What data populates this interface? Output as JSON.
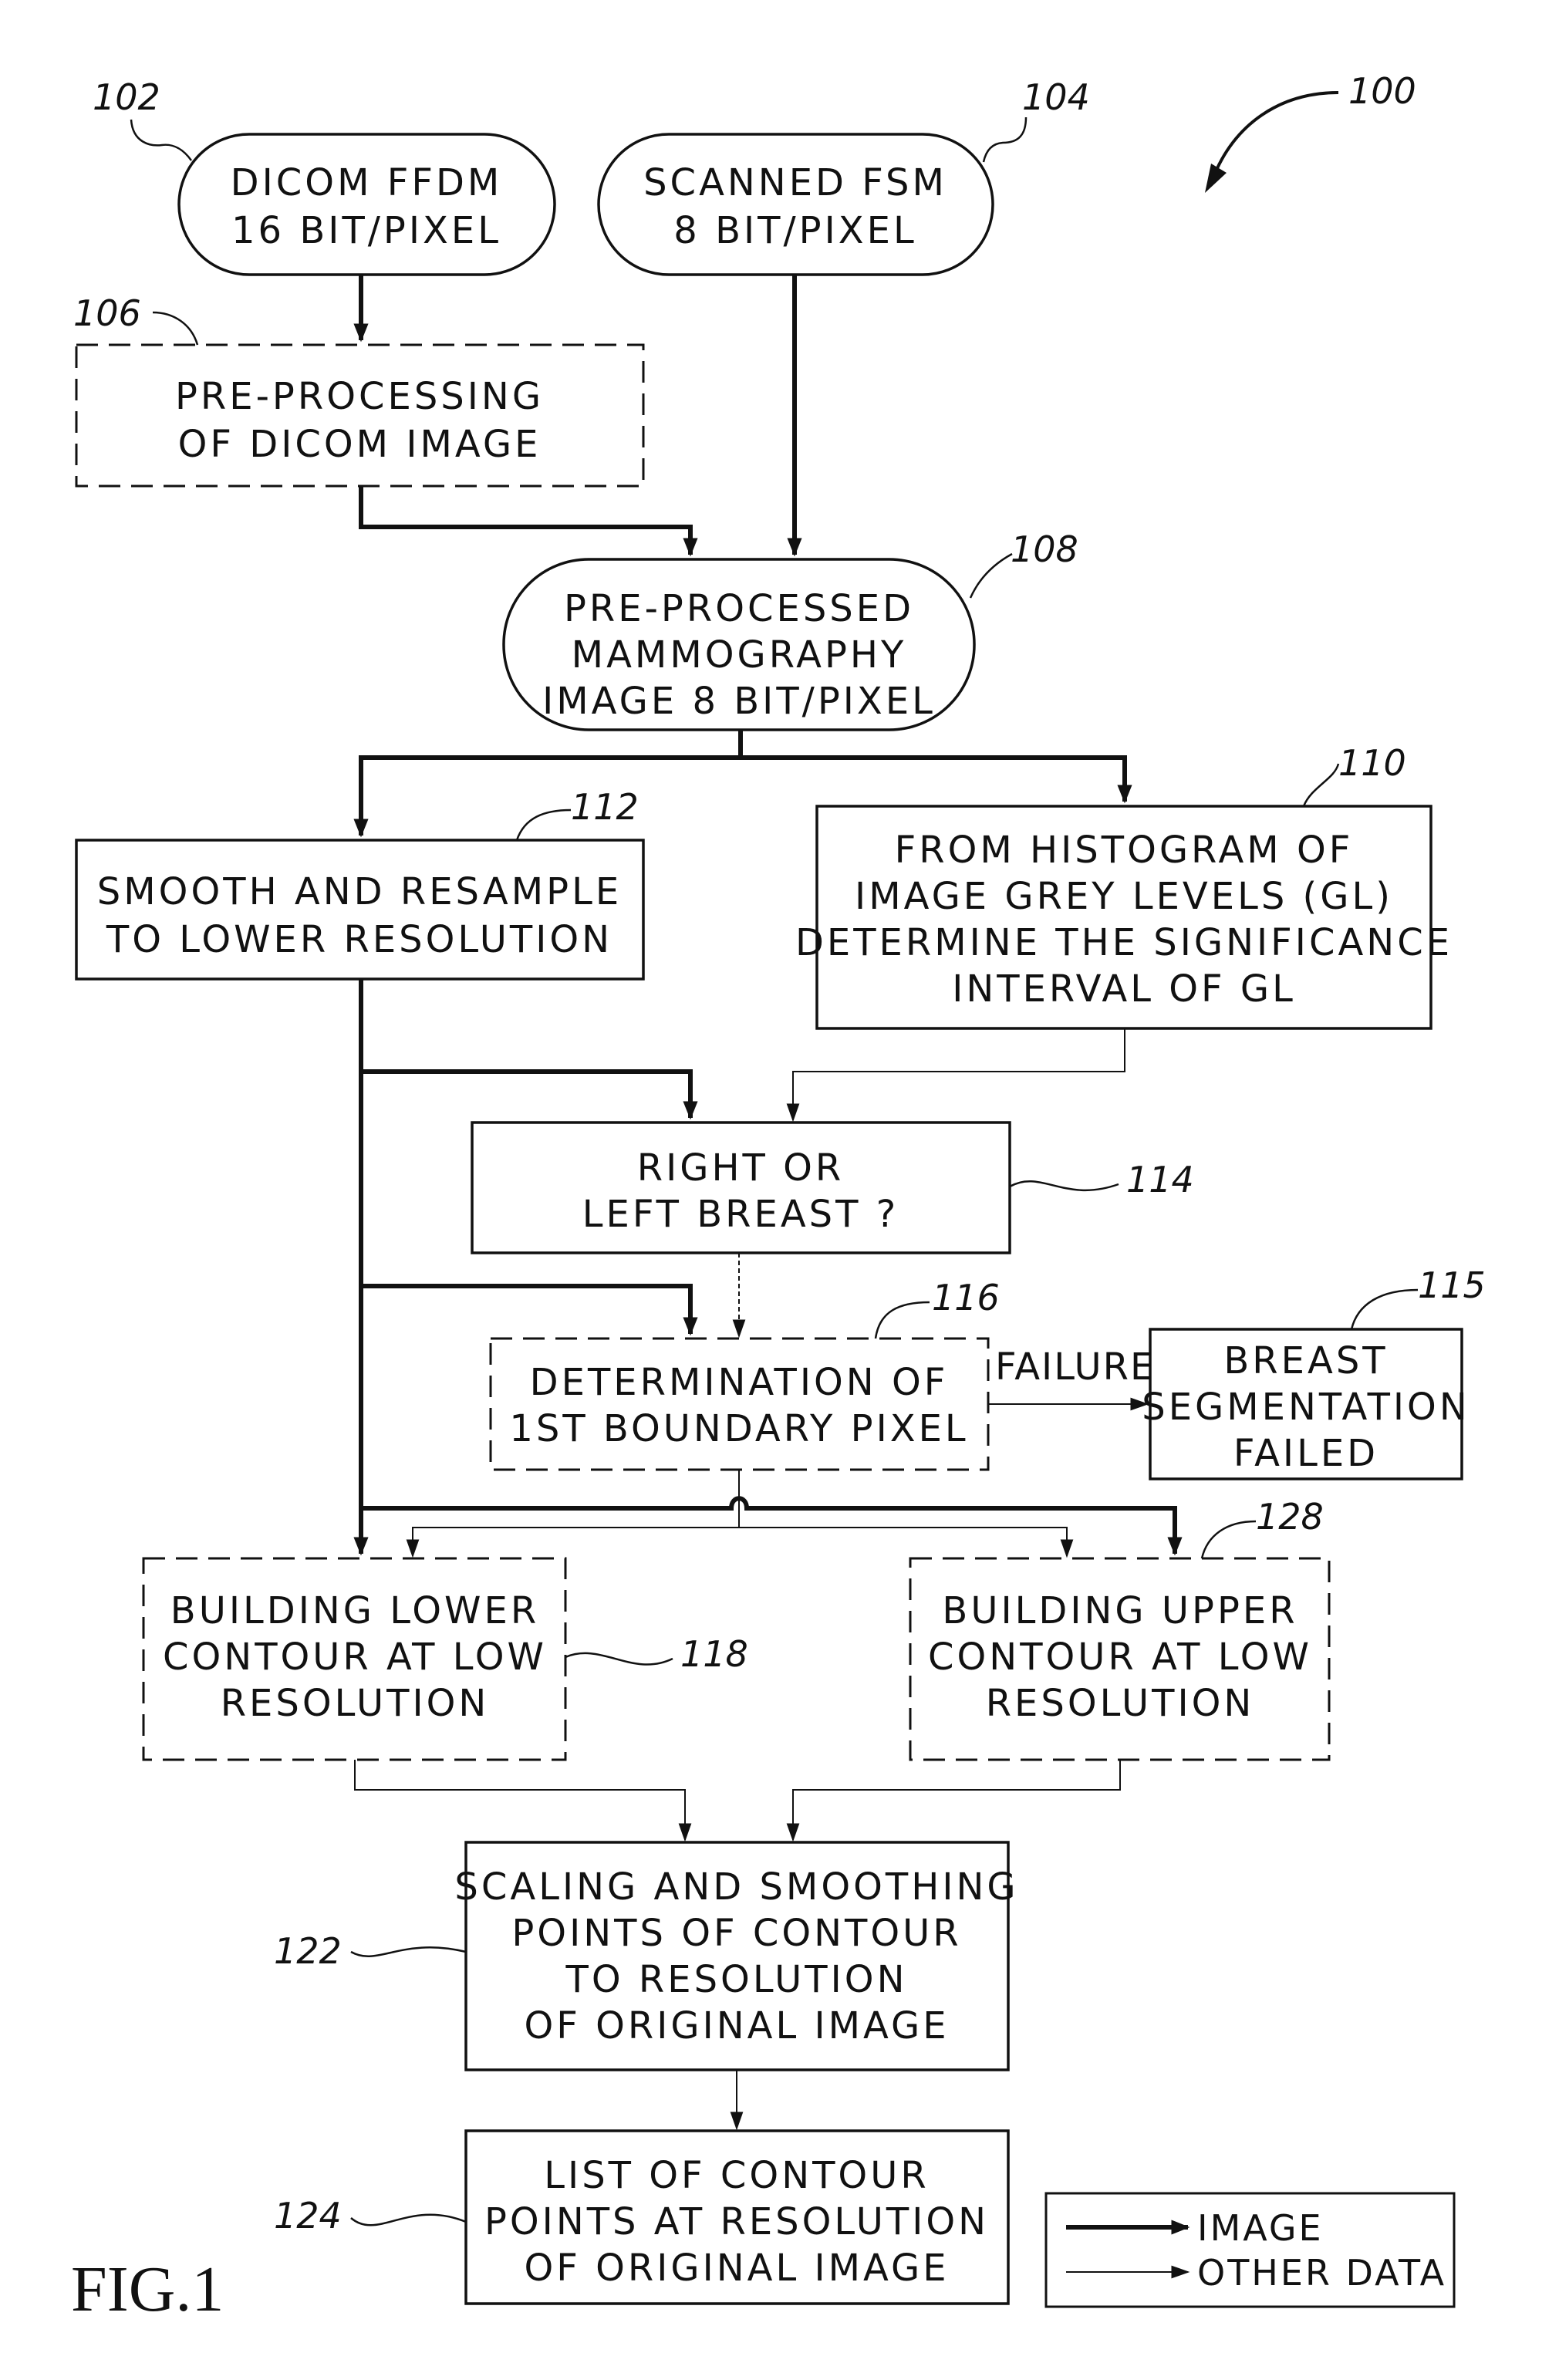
{
  "figure": {
    "label": "FIG.1",
    "ref": "100"
  },
  "nodes": {
    "n102": {
      "ref": "102",
      "lines": [
        "DICOM FFDM",
        "16 BIT/PIXEL"
      ],
      "shape": "terminal"
    },
    "n104": {
      "ref": "104",
      "lines": [
        "SCANNED FSM",
        "8 BIT/PIXEL"
      ],
      "shape": "terminal"
    },
    "n106": {
      "ref": "106",
      "lines": [
        "PRE-PROCESSING",
        "OF DICOM IMAGE"
      ],
      "shape": "dashed-box"
    },
    "n108": {
      "ref": "108",
      "lines": [
        "PRE-PROCESSED",
        "MAMMOGRAPHY",
        "IMAGE 8 BIT/PIXEL"
      ],
      "shape": "terminal"
    },
    "n110": {
      "ref": "110",
      "lines": [
        "FROM HISTOGRAM OF",
        "IMAGE GREY LEVELS (GL)",
        "DETERMINE THE SIGNIFICANCE",
        "INTERVAL OF GL"
      ],
      "shape": "box"
    },
    "n112": {
      "ref": "112",
      "lines": [
        "SMOOTH AND RESAMPLE",
        "TO LOWER RESOLUTION"
      ],
      "shape": "box"
    },
    "n114": {
      "ref": "114",
      "lines": [
        "RIGHT OR",
        "LEFT BREAST ?"
      ],
      "shape": "box"
    },
    "n116": {
      "ref": "116",
      "lines": [
        "DETERMINATION OF",
        "1ST BOUNDARY PIXEL"
      ],
      "shape": "dashed-box"
    },
    "n115": {
      "ref": "115",
      "lines": [
        "BREAST",
        "SEGMENTATION",
        "FAILED"
      ],
      "shape": "box"
    },
    "n118": {
      "ref": "118",
      "lines": [
        "BUILDING LOWER",
        "CONTOUR AT LOW",
        "RESOLUTION"
      ],
      "shape": "dashed-box"
    },
    "n128": {
      "ref": "128",
      "lines": [
        "BUILDING UPPER",
        "CONTOUR AT LOW",
        "RESOLUTION"
      ],
      "shape": "dashed-box"
    },
    "n122": {
      "ref": "122",
      "lines": [
        "SCALING AND SMOOTHING",
        "POINTS OF CONTOUR",
        "TO RESOLUTION",
        "OF ORIGINAL IMAGE"
      ],
      "shape": "box"
    },
    "n124": {
      "ref": "124",
      "lines": [
        "LIST OF CONTOUR",
        "POINTS AT RESOLUTION",
        "OF ORIGINAL IMAGE"
      ],
      "shape": "box"
    }
  },
  "edge_labels": {
    "failure": "FAILURE"
  },
  "legend": {
    "items": [
      {
        "label": "IMAGE",
        "style": "thick"
      },
      {
        "label": "OTHER DATA",
        "style": "thin"
      }
    ]
  }
}
